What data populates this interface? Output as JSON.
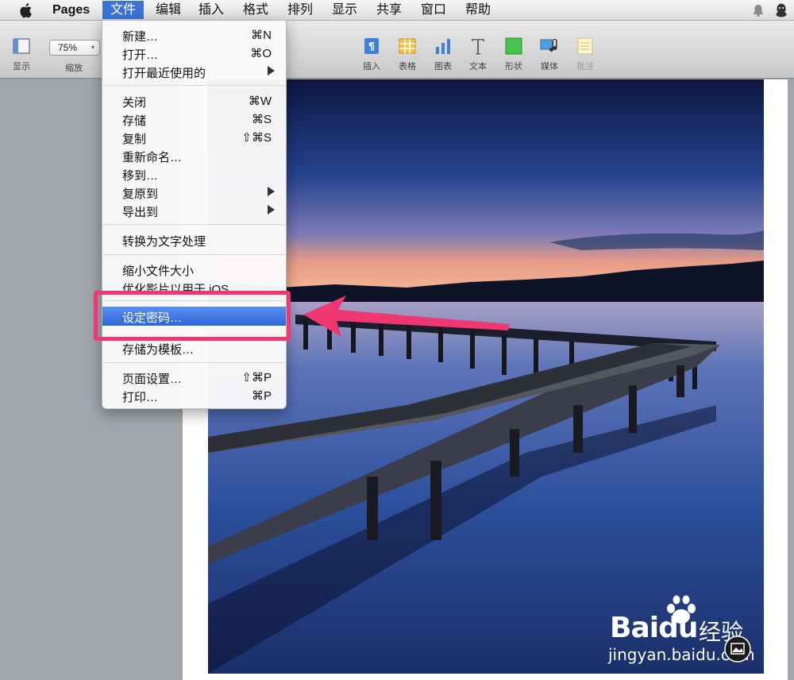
{
  "menubar": {
    "app_name": "Pages",
    "items": [
      "文件",
      "编辑",
      "插入",
      "格式",
      "排列",
      "显示",
      "共享",
      "窗口",
      "帮助"
    ]
  },
  "toolbar": {
    "view_label": "显示",
    "zoom_value": "75%",
    "zoom_label": "缩放",
    "buttons": [
      {
        "label": "插入",
        "icon": "insert-icon"
      },
      {
        "label": "表格",
        "icon": "table-icon"
      },
      {
        "label": "图表",
        "icon": "chart-icon"
      },
      {
        "label": "文本",
        "icon": "text-icon"
      },
      {
        "label": "形状",
        "icon": "shape-icon"
      },
      {
        "label": "媒体",
        "icon": "media-icon"
      },
      {
        "label": "批注",
        "icon": "comment-icon"
      }
    ]
  },
  "file_menu": {
    "items": [
      {
        "label": "新建…",
        "shortcut": "⌘N"
      },
      {
        "label": "打开…",
        "shortcut": "⌘O"
      },
      {
        "label": "打开最近使用的",
        "shortcut": ""
      },
      {
        "label": "关闭",
        "shortcut": "⌘W"
      },
      {
        "label": "存储",
        "shortcut": "⌘S"
      },
      {
        "label": "复制",
        "shortcut": "⇧⌘S"
      },
      {
        "label": "重新命名…",
        "shortcut": ""
      },
      {
        "label": "移到…",
        "shortcut": ""
      },
      {
        "label": "复原到",
        "shortcut": ""
      },
      {
        "label": "导出到",
        "shortcut": ""
      },
      {
        "label": "转换为文字处理",
        "shortcut": ""
      },
      {
        "label": "缩小文件大小",
        "shortcut": ""
      },
      {
        "label": "优化影片以用于 iOS",
        "shortcut": ""
      },
      {
        "label": "设定密码…",
        "shortcut": ""
      },
      {
        "label": "存储为模板…",
        "shortcut": ""
      },
      {
        "label": "页面设置…",
        "shortcut": "⇧⌘P"
      },
      {
        "label": "打印…",
        "shortcut": "⌘P"
      }
    ]
  },
  "watermark": {
    "brand": "Bai",
    "brand2": "du",
    "cn": "经验",
    "url": "jingyan.baidu.com"
  },
  "colors": {
    "menu_highlight": "#3c74d6",
    "annotation": "#ef3872"
  }
}
